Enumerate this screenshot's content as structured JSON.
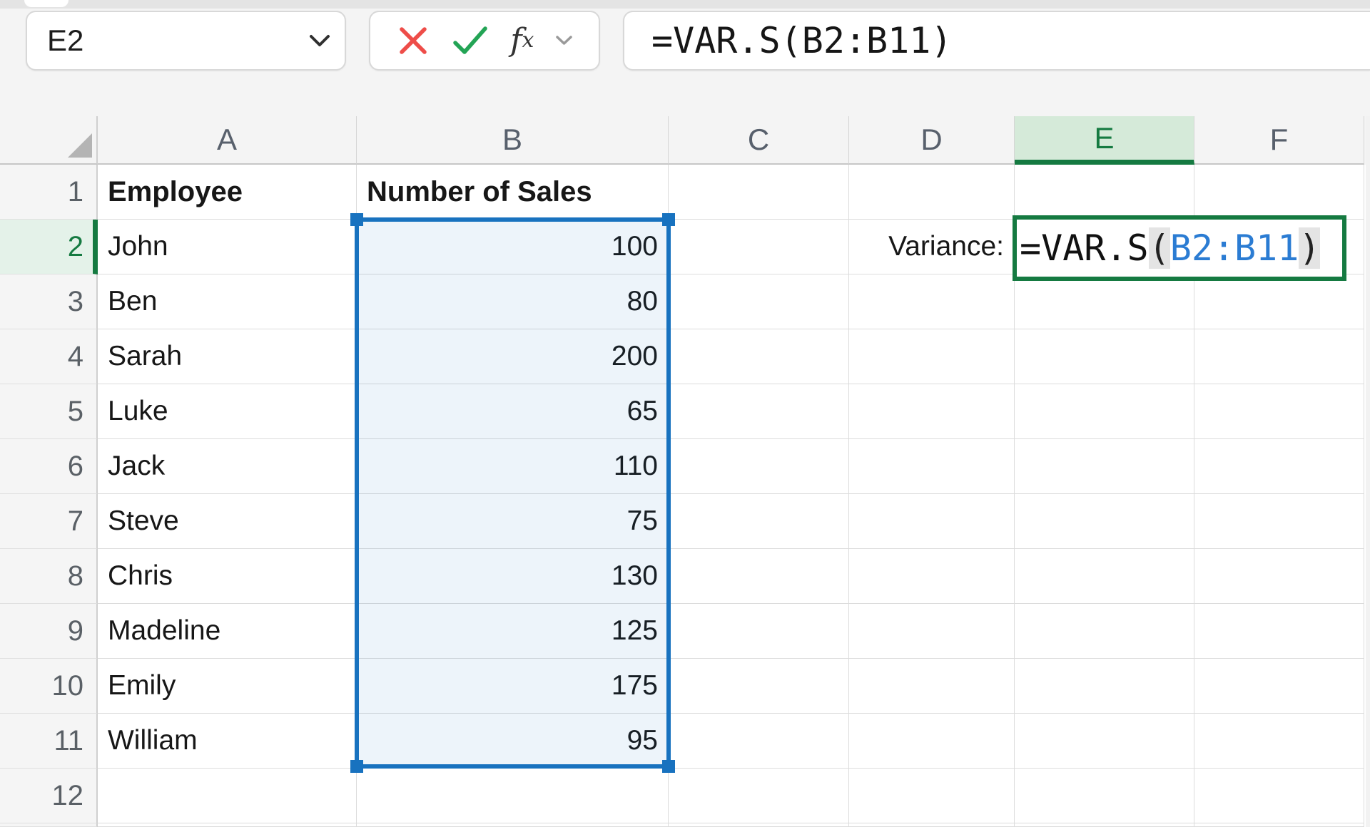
{
  "toolbar": {
    "name_box_value": "E2",
    "formula_bar_value": "=VAR.S(B2:B11)",
    "fx_f": "f",
    "fx_x": "x"
  },
  "sheet": {
    "columns": [
      "A",
      "B",
      "C",
      "D",
      "E",
      "F"
    ],
    "selected_column": "E",
    "selected_row": "2",
    "rows": [
      {
        "num": "1",
        "cells": [
          {
            "col": "A",
            "text": "Employee",
            "bold": true
          },
          {
            "col": "B",
            "text": "Number of Sales",
            "bold": true
          }
        ]
      },
      {
        "num": "2",
        "selected": true,
        "cells": [
          {
            "col": "A",
            "text": "John"
          },
          {
            "col": "B",
            "text": "100",
            "align": "right"
          },
          {
            "col": "D",
            "text": "Variance:",
            "align": "right"
          }
        ]
      },
      {
        "num": "3",
        "cells": [
          {
            "col": "A",
            "text": "Ben"
          },
          {
            "col": "B",
            "text": "80",
            "align": "right"
          }
        ]
      },
      {
        "num": "4",
        "cells": [
          {
            "col": "A",
            "text": "Sarah"
          },
          {
            "col": "B",
            "text": "200",
            "align": "right"
          }
        ]
      },
      {
        "num": "5",
        "cells": [
          {
            "col": "A",
            "text": "Luke"
          },
          {
            "col": "B",
            "text": "65",
            "align": "right"
          }
        ]
      },
      {
        "num": "6",
        "cells": [
          {
            "col": "A",
            "text": "Jack"
          },
          {
            "col": "B",
            "text": "110",
            "align": "right"
          }
        ]
      },
      {
        "num": "7",
        "cells": [
          {
            "col": "A",
            "text": "Steve"
          },
          {
            "col": "B",
            "text": "75",
            "align": "right"
          }
        ]
      },
      {
        "num": "8",
        "cells": [
          {
            "col": "A",
            "text": "Chris"
          },
          {
            "col": "B",
            "text": "130",
            "align": "right"
          }
        ]
      },
      {
        "num": "9",
        "cells": [
          {
            "col": "A",
            "text": "Madeline"
          },
          {
            "col": "B",
            "text": "125",
            "align": "right"
          }
        ]
      },
      {
        "num": "10",
        "cells": [
          {
            "col": "A",
            "text": "Emily"
          },
          {
            "col": "B",
            "text": "175",
            "align": "right"
          }
        ]
      },
      {
        "num": "11",
        "cells": [
          {
            "col": "A",
            "text": "William"
          },
          {
            "col": "B",
            "text": "95",
            "align": "right"
          }
        ]
      },
      {
        "num": "12",
        "cells": []
      }
    ],
    "selection": {
      "range": "B2:B11"
    },
    "active_cell": {
      "ref": "E2",
      "formula_parts": [
        {
          "text": "=VAR.S",
          "style": "plain"
        },
        {
          "text": "(",
          "style": "paren"
        },
        {
          "text": "B2:B11",
          "style": "ref"
        },
        {
          "text": ")",
          "style": "paren"
        }
      ]
    }
  },
  "colors": {
    "accent_green": "#157A41",
    "selection_blue": "#1872BF",
    "reference_blue": "#2B7CD3",
    "cancel_red": "#EE4D49",
    "confirm_green": "#23A455",
    "selection_fill": "#E9F1F9"
  }
}
